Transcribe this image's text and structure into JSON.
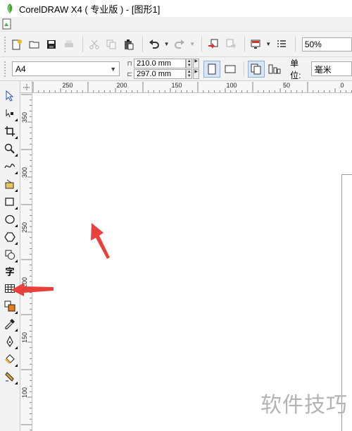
{
  "window": {
    "title": "CorelDRAW X4 ( 专业版 ) - [图形1]"
  },
  "toolbar": {
    "zoom_level": "50%"
  },
  "property_bar": {
    "paper_size": "A4",
    "width": "210.0 mm",
    "height": "297.0 mm",
    "unit_label": "单位:",
    "unit_value": "毫米"
  },
  "ruler_horizontal": {
    "labels": [
      "250",
      "200",
      "150",
      "100",
      "50",
      "0"
    ]
  },
  "ruler_vertical": {
    "labels": [
      "350",
      "300",
      "250",
      "200",
      "150",
      "100"
    ]
  },
  "toolbox": {
    "text_tool_glyph": "字"
  },
  "watermark": {
    "text": "软件技巧"
  },
  "colors": {
    "annotation_arrow": "#e8413b",
    "toolbar_bg": "#f3f3f3"
  }
}
